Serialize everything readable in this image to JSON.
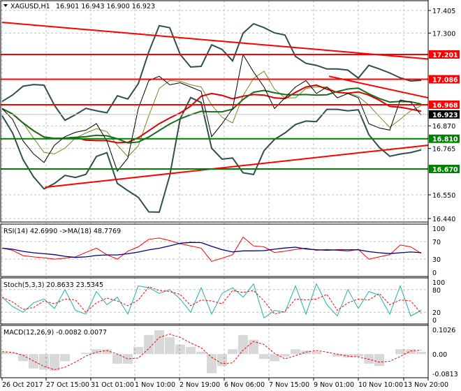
{
  "header": {
    "symbol": "XAGUSD,H1",
    "ohlc": "16.901 16.943 16.900 16.923"
  },
  "chart_data": [
    {
      "type": "line",
      "title": "XAGUSD,H1",
      "ylim": [
        16.44,
        17.405
      ],
      "y_ticks": [
        "17.405",
        "17.300",
        "16.870",
        "16.765",
        "16.550",
        "16.440"
      ],
      "x_labels": [
        "26 Oct 2017",
        "27 Oct 15:00",
        "31 Oct 01:00",
        "1 Nov 10:00",
        "2 Nov 19:00",
        "6 Nov 06:00",
        "7 Nov 15:00",
        "9 Nov 01:00",
        "10 Nov 10:00",
        "13 Nov 20:00"
      ],
      "close": [
        16.95,
        16.9,
        16.8,
        16.74,
        16.7,
        16.78,
        16.82,
        16.84,
        16.85,
        16.88,
        16.8,
        16.66,
        16.72,
        16.95,
        17.08,
        17.1,
        17.06,
        17.07,
        17.05,
        17.03,
        16.82,
        16.88,
        16.95,
        17.2,
        17.12,
        17.05,
        16.95,
        17.0,
        17.05,
        17.08,
        17.02,
        17.05,
        17.0,
        17.02,
        17.0,
        16.88,
        16.86,
        16.85,
        16.99,
        16.98,
        16.92
      ],
      "levels": [
        {
          "label": "17.201",
          "value": 17.201,
          "color": "#ff0000"
        },
        {
          "label": "17.086",
          "value": 17.086,
          "color": "#ff0000"
        },
        {
          "label": "16.968",
          "value": 16.968,
          "color": "#ff0000"
        },
        {
          "label": "16.810",
          "value": 16.81,
          "color": "#008000"
        },
        {
          "label": "16.670",
          "value": 16.67,
          "color": "#008000"
        }
      ],
      "current_price": {
        "label": "16.923",
        "value": 16.923,
        "color": "#000000"
      },
      "trendlines": [
        {
          "from": [
            0,
            17.35
          ],
          "to": [
            40.7,
            17.18
          ]
        },
        {
          "from": [
            4.1,
            16.585
          ],
          "to": [
            40.7,
            16.78
          ]
        },
        {
          "from": [
            31.2,
            17.1
          ],
          "to": [
            40.7,
            17.0
          ]
        }
      ]
    },
    {
      "type": "line",
      "title": "RSI(14) 42.6990  ->MA(18) 48.7769",
      "ylim": [
        0,
        100
      ],
      "y_ticks": [
        "100",
        "70",
        "30",
        "0"
      ],
      "values": [
        55,
        50,
        38,
        35,
        33,
        30,
        32,
        35,
        45,
        55,
        40,
        30,
        48,
        58,
        75,
        78,
        72,
        65,
        60,
        55,
        25,
        32,
        40,
        80,
        60,
        58,
        45,
        48,
        52,
        55,
        50,
        52,
        50,
        48,
        52,
        30,
        35,
        40,
        62,
        58,
        43
      ]
    },
    {
      "type": "line",
      "title": "Stoch(5,3,3) 20.8633 23.5345",
      "ylim": [
        0,
        100
      ],
      "y_ticks": [
        "100",
        "80",
        "20",
        "0"
      ],
      "values": [
        60,
        35,
        20,
        45,
        55,
        30,
        80,
        25,
        15,
        75,
        40,
        60,
        15,
        90,
        85,
        70,
        80,
        55,
        20,
        85,
        15,
        70,
        85,
        60,
        95,
        5,
        25,
        20,
        90,
        15,
        95,
        40,
        10,
        80,
        30,
        75,
        65,
        15,
        90,
        10,
        25
      ]
    },
    {
      "type": "bar",
      "title": "MACD(12,26,9) -0.0082 0.0077",
      "ylim": [
        -0.0813,
        0.1026
      ],
      "y_ticks": [
        "0.1026",
        "0.00",
        "-0.0813"
      ],
      "values": [
        0.01,
        0.005,
        -0.03,
        -0.06,
        -0.065,
        -0.07,
        -0.03,
        0,
        0.005,
        0.02,
        0.02,
        -0.04,
        -0.04,
        0.03,
        0.08,
        0.1,
        0.07,
        0.04,
        0.03,
        0.01,
        -0.08,
        -0.05,
        0.02,
        0.08,
        0.06,
        -0.02,
        -0.03,
        -0.01,
        0.02,
        0.015,
        0.01,
        0,
        -0.01,
        -0.015,
        -0.01,
        -0.04,
        -0.05,
        0,
        0.02,
        0.02,
        0.01
      ]
    }
  ]
}
